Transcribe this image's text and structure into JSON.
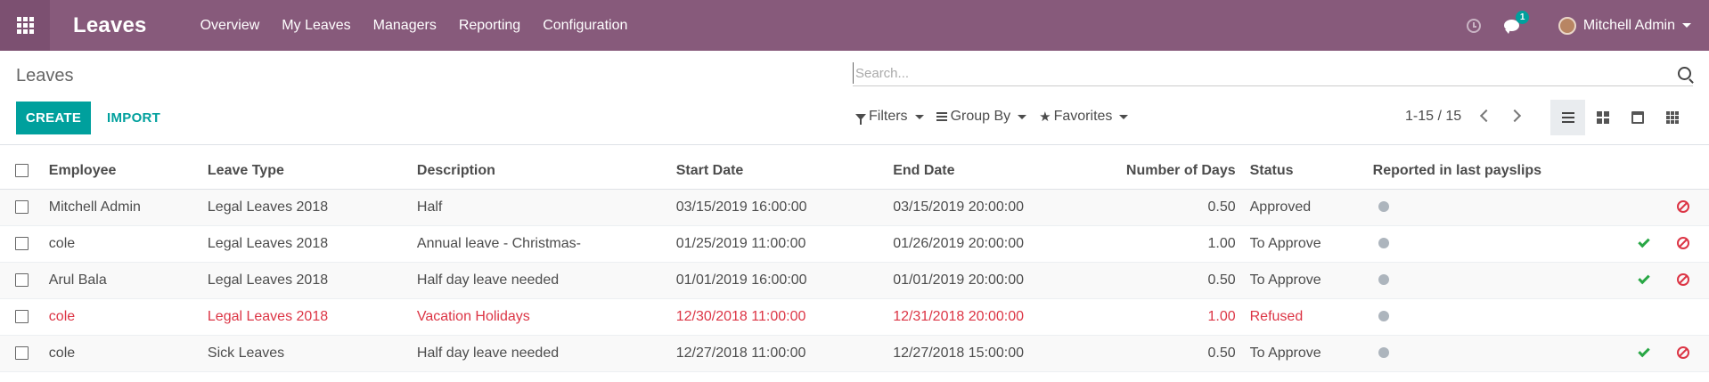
{
  "navbar": {
    "app_title": "Leaves",
    "menu": [
      "Overview",
      "My Leaves",
      "Managers",
      "Reporting",
      "Configuration"
    ],
    "chat_count": "1",
    "user_name": "Mitchell Admin"
  },
  "control_panel": {
    "breadcrumb": "Leaves",
    "search_placeholder": "Search...",
    "create_label": "CREATE",
    "import_label": "IMPORT",
    "filters_label": "Filters",
    "groupby_label": "Group By",
    "favorites_label": "Favorites",
    "pager": "1-15 / 15"
  },
  "table": {
    "columns": [
      "Employee",
      "Leave Type",
      "Description",
      "Start Date",
      "End Date",
      "Number of Days",
      "Status",
      "Reported in last payslips"
    ],
    "rows": [
      {
        "employee": "Mitchell Admin",
        "leave_type": "Legal Leaves 2018",
        "description": "Half",
        "start": "03/15/2019 16:00:00",
        "end": "03/15/2019 20:00:00",
        "days": "0.50",
        "status": "Approved"
      },
      {
        "employee": "cole",
        "leave_type": "Legal Leaves 2018",
        "description": "Annual leave - Christmas-",
        "start": "01/25/2019 11:00:00",
        "end": "01/26/2019 20:00:00",
        "days": "1.00",
        "status": "To Approve"
      },
      {
        "employee": "Arul Bala",
        "leave_type": "Legal Leaves 2018",
        "description": "Half day leave needed",
        "start": "01/01/2019 16:00:00",
        "end": "01/01/2019 20:00:00",
        "days": "0.50",
        "status": "To Approve"
      },
      {
        "employee": "cole",
        "leave_type": "Legal Leaves 2018",
        "description": "Vacation Holidays",
        "start": "12/30/2018 11:00:00",
        "end": "12/31/2018 20:00:00",
        "days": "1.00",
        "status": "Refused"
      },
      {
        "employee": "cole",
        "leave_type": "Sick Leaves",
        "description": "Half day leave needed",
        "start": "12/27/2018 11:00:00",
        "end": "12/27/2018 15:00:00",
        "days": "0.50",
        "status": "To Approve"
      }
    ]
  },
  "colors": {
    "brand": "#875a7b",
    "accent": "#00a09d",
    "refused": "#dc3545",
    "approve": "#28a745"
  }
}
